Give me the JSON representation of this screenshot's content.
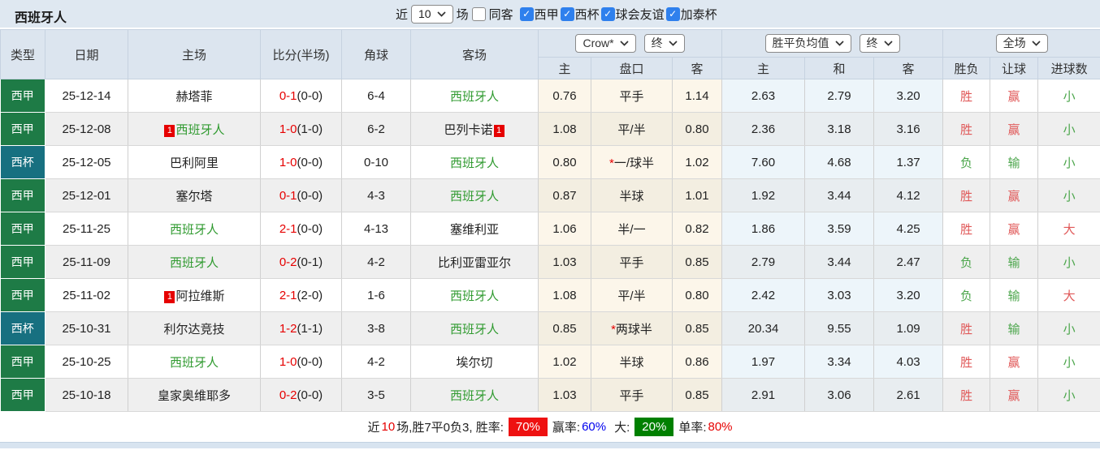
{
  "topbar": {
    "title": "西班牙人",
    "near": "近",
    "match_count": "10",
    "games": "场",
    "same_opponent": "同客",
    "filters": [
      {
        "label": "西甲",
        "checked": true
      },
      {
        "label": "西杯",
        "checked": true
      },
      {
        "label": "球会友谊",
        "checked": true
      },
      {
        "label": "加泰杯",
        "checked": true
      }
    ]
  },
  "table_header": {
    "type": "类型",
    "date": "日期",
    "home": "主场",
    "score": "比分(半场)",
    "corner": "角球",
    "away": "客场",
    "bookmaker_select": "Crow*",
    "bookmaker_period_select": "终",
    "odds_select": "胜平负均值",
    "odds_period_select": "终",
    "scope_select": "全场",
    "sub_handicap_home": "主",
    "sub_handicap": "盘口",
    "sub_handicap_away": "客",
    "sub_odds_home": "主",
    "sub_odds_draw": "和",
    "sub_odds_away": "客",
    "sub_wdl": "胜负",
    "sub_let": "让球",
    "sub_goals": "进球数"
  },
  "rows": [
    {
      "comp": "西甲",
      "comp_type": "league",
      "date": "25-12-14",
      "home": "赫塔菲",
      "home_self": false,
      "home_red": "",
      "score": "0-1",
      "half": "(0-0)",
      "corner": "6-4",
      "away": "西班牙人",
      "away_self": true,
      "away_red": "",
      "water_home": "0.76",
      "handicap": "平手",
      "handicap_star": false,
      "water_away": "1.14",
      "odds_home": "2.63",
      "odds_draw": "2.79",
      "odds_away": "3.20",
      "result_wdl": "胜",
      "result_wdl_color": "red",
      "result_let": "赢",
      "result_let_color": "red",
      "result_goals": "小",
      "result_goals_color": "green"
    },
    {
      "comp": "西甲",
      "comp_type": "league",
      "date": "25-12-08",
      "home": "西班牙人",
      "home_self": true,
      "home_red": "1",
      "score": "1-0",
      "half": "(1-0)",
      "corner": "6-2",
      "away": "巴列卡诺",
      "away_self": false,
      "away_red": "1",
      "water_home": "1.08",
      "handicap": "平/半",
      "handicap_star": false,
      "water_away": "0.80",
      "odds_home": "2.36",
      "odds_draw": "3.18",
      "odds_away": "3.16",
      "result_wdl": "胜",
      "result_wdl_color": "red",
      "result_let": "赢",
      "result_let_color": "red",
      "result_goals": "小",
      "result_goals_color": "green"
    },
    {
      "comp": "西杯",
      "comp_type": "cup",
      "date": "25-12-05",
      "home": "巴利阿里",
      "home_self": false,
      "home_red": "",
      "score": "1-0",
      "half": "(0-0)",
      "corner": "0-10",
      "away": "西班牙人",
      "away_self": true,
      "away_red": "",
      "water_home": "0.80",
      "handicap": "一/球半",
      "handicap_star": true,
      "water_away": "1.02",
      "odds_home": "7.60",
      "odds_draw": "4.68",
      "odds_away": "1.37",
      "result_wdl": "负",
      "result_wdl_color": "green",
      "result_let": "输",
      "result_let_color": "green",
      "result_goals": "小",
      "result_goals_color": "green"
    },
    {
      "comp": "西甲",
      "comp_type": "league",
      "date": "25-12-01",
      "home": "塞尔塔",
      "home_self": false,
      "home_red": "",
      "score": "0-1",
      "half": "(0-0)",
      "corner": "4-3",
      "away": "西班牙人",
      "away_self": true,
      "away_red": "",
      "water_home": "0.87",
      "handicap": "半球",
      "handicap_star": false,
      "water_away": "1.01",
      "odds_home": "1.92",
      "odds_draw": "3.44",
      "odds_away": "4.12",
      "result_wdl": "胜",
      "result_wdl_color": "red",
      "result_let": "赢",
      "result_let_color": "red",
      "result_goals": "小",
      "result_goals_color": "green"
    },
    {
      "comp": "西甲",
      "comp_type": "league",
      "date": "25-11-25",
      "home": "西班牙人",
      "home_self": true,
      "home_red": "",
      "score": "2-1",
      "half": "(0-0)",
      "corner": "4-13",
      "away": "塞维利亚",
      "away_self": false,
      "away_red": "",
      "water_home": "1.06",
      "handicap": "半/一",
      "handicap_star": false,
      "water_away": "0.82",
      "odds_home": "1.86",
      "odds_draw": "3.59",
      "odds_away": "4.25",
      "result_wdl": "胜",
      "result_wdl_color": "red",
      "result_let": "赢",
      "result_let_color": "red",
      "result_goals": "大",
      "result_goals_color": "red"
    },
    {
      "comp": "西甲",
      "comp_type": "league",
      "date": "25-11-09",
      "home": "西班牙人",
      "home_self": true,
      "home_red": "",
      "score": "0-2",
      "half": "(0-1)",
      "corner": "4-2",
      "away": "比利亚雷亚尔",
      "away_self": false,
      "away_red": "",
      "water_home": "1.03",
      "handicap": "平手",
      "handicap_star": false,
      "water_away": "0.85",
      "odds_home": "2.79",
      "odds_draw": "3.44",
      "odds_away": "2.47",
      "result_wdl": "负",
      "result_wdl_color": "green",
      "result_let": "输",
      "result_let_color": "green",
      "result_goals": "小",
      "result_goals_color": "green"
    },
    {
      "comp": "西甲",
      "comp_type": "league",
      "date": "25-11-02",
      "home": "阿拉维斯",
      "home_self": false,
      "home_red": "1",
      "score": "2-1",
      "half": "(2-0)",
      "corner": "1-6",
      "away": "西班牙人",
      "away_self": true,
      "away_red": "",
      "water_home": "1.08",
      "handicap": "平/半",
      "handicap_star": false,
      "water_away": "0.80",
      "odds_home": "2.42",
      "odds_draw": "3.03",
      "odds_away": "3.20",
      "result_wdl": "负",
      "result_wdl_color": "green",
      "result_let": "输",
      "result_let_color": "green",
      "result_goals": "大",
      "result_goals_color": "red"
    },
    {
      "comp": "西杯",
      "comp_type": "cup",
      "date": "25-10-31",
      "home": "利尔达竞技",
      "home_self": false,
      "home_red": "",
      "score": "1-2",
      "half": "(1-1)",
      "corner": "3-8",
      "away": "西班牙人",
      "away_self": true,
      "away_red": "",
      "water_home": "0.85",
      "handicap": "两球半",
      "handicap_star": true,
      "water_away": "0.85",
      "odds_home": "20.34",
      "odds_draw": "9.55",
      "odds_away": "1.09",
      "result_wdl": "胜",
      "result_wdl_color": "red",
      "result_let": "输",
      "result_let_color": "green",
      "result_goals": "小",
      "result_goals_color": "green"
    },
    {
      "comp": "西甲",
      "comp_type": "league",
      "date": "25-10-25",
      "home": "西班牙人",
      "home_self": true,
      "home_red": "",
      "score": "1-0",
      "half": "(0-0)",
      "corner": "4-2",
      "away": "埃尔切",
      "away_self": false,
      "away_red": "",
      "water_home": "1.02",
      "handicap": "半球",
      "handicap_star": false,
      "water_away": "0.86",
      "odds_home": "1.97",
      "odds_draw": "3.34",
      "odds_away": "4.03",
      "result_wdl": "胜",
      "result_wdl_color": "red",
      "result_let": "赢",
      "result_let_color": "red",
      "result_goals": "小",
      "result_goals_color": "green"
    },
    {
      "comp": "西甲",
      "comp_type": "league",
      "date": "25-10-18",
      "home": "皇家奥维耶多",
      "home_self": false,
      "home_red": "",
      "score": "0-2",
      "half": "(0-0)",
      "corner": "3-5",
      "away": "西班牙人",
      "away_self": true,
      "away_red": "",
      "water_home": "1.03",
      "handicap": "平手",
      "handicap_star": false,
      "water_away": "0.85",
      "odds_home": "2.91",
      "odds_draw": "3.06",
      "odds_away": "2.61",
      "result_wdl": "胜",
      "result_wdl_color": "red",
      "result_let": "赢",
      "result_let_color": "red",
      "result_goals": "小",
      "result_goals_color": "green"
    }
  ],
  "summary": {
    "part1": "近",
    "count": "10",
    "part2": "场,胜7平0负3, 胜率:",
    "win_rate": "70%",
    "part3": "赢率:",
    "profit_rate": "60%",
    "part4": "大:",
    "big_rate": "20%",
    "part5": "单率:",
    "single_rate": "80%"
  },
  "colors": {
    "league_bg": "#1e7b46",
    "cup_bg": "#177080",
    "self_team_green": "#2f9a2f",
    "score_red": "#e60000",
    "result_red": "#e05858",
    "result_green": "#4ca64c",
    "badge_red_bg": "#ee1111",
    "badge_green_bg": "#008000",
    "rate_blue": "#0000ee",
    "checkbox_blue": "#2f80ed",
    "header_bg": "#dce5ef",
    "topbar_bg": "#dfe8f1"
  }
}
